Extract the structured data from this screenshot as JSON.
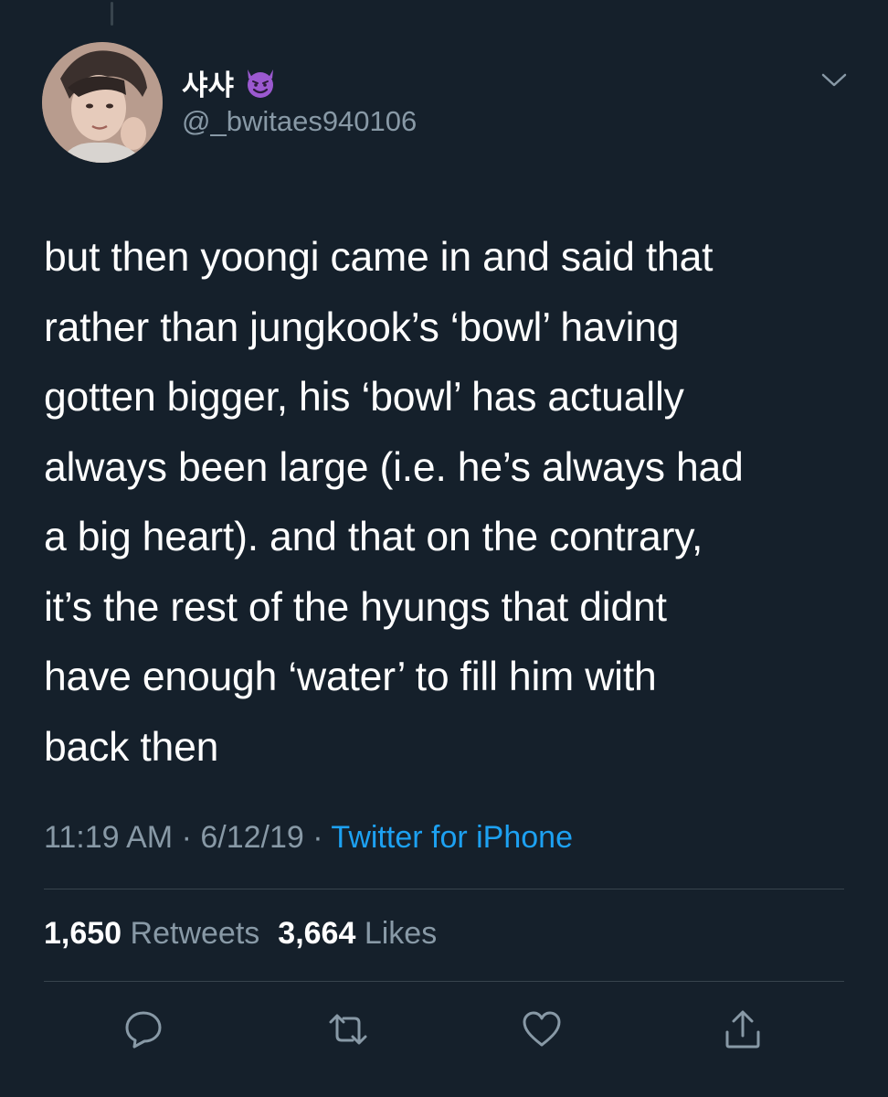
{
  "author": {
    "display_name": "샤샤",
    "name_emoji": "smiling-devil-emoji",
    "handle": "@_bwitaes940106"
  },
  "tweet": {
    "lines": [
      "but then yoongi came in and said that",
      "rather than jungkook’s ‘bowl’ having",
      "gotten bigger, his ‘bowl’ has actually",
      "always been large (i.e. he’s always had",
      "a big heart). and that on the contrary,",
      "it’s the rest of the hyungs that didnt",
      "have enough ‘water’ to fill him with",
      "back then"
    ]
  },
  "meta": {
    "time": "11:19 AM",
    "sep1": " · ",
    "date": "6/12/19",
    "sep2": " · ",
    "source": "Twitter for iPhone"
  },
  "stats": {
    "retweets_count": "1,650",
    "retweets_label": "Retweets",
    "likes_count": "3,664",
    "likes_label": "Likes"
  },
  "actions": {
    "icons": [
      "reply-icon",
      "retweet-icon",
      "like-icon",
      "share-icon"
    ]
  },
  "colors": {
    "background": "#15202b",
    "text": "#ffffff",
    "muted": "#8899a6",
    "accent": "#1da1f2",
    "divider": "#38444d"
  }
}
